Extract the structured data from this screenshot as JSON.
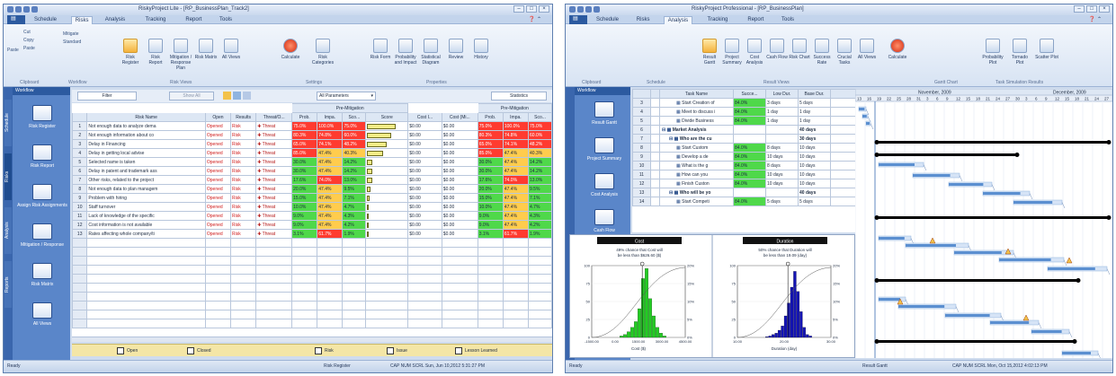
{
  "colors": {
    "accent": "#2c5aa0",
    "sidebar": "#5a86c9",
    "high": "#ff3b30",
    "medium": "#ffcc4d",
    "low": "#4fd84a",
    "histogram_cost": "#22cc22",
    "histogram_duration": "#1414b4",
    "gantt_bar": "#5b8fd0",
    "summary_bar": "#000000"
  },
  "left": {
    "title": "RiskyProject Lite - [RP_BusinessPlan_Track2]",
    "tabs": [
      "Schedule",
      "Risks",
      "Analysis",
      "Tracking",
      "Report",
      "Tools"
    ],
    "active_tab": "Risks",
    "ribbon": {
      "clipboard": [
        "Cut",
        "Copy",
        "Paste"
      ],
      "clipboard_label": "Clipboard",
      "workflow": [
        "Mitigate",
        "Standard"
      ],
      "workflow_label": "Workflow",
      "views": [
        "Risk Register",
        "Risk Report",
        "Mitigation / Response Plan",
        "Risk Matrix",
        "All Views"
      ],
      "views_label": "Risk Views",
      "settings": [
        "Calculate",
        "Risk Categories"
      ],
      "settings_label": "Settings",
      "properties": [
        "Risk Form",
        "Probability and Impact",
        "Statistical Diagram",
        "Review",
        "History"
      ],
      "properties_label": "Properties"
    },
    "sidebar": {
      "header": "Workflow",
      "vtabs": [
        "Schedule",
        "Risks",
        "Analysis",
        "Reports"
      ],
      "items": [
        "Risk Register",
        "Risk Report",
        "Assign Risk Assignments",
        "Mitigation / Response",
        "Risk Matrix",
        "All Views"
      ]
    },
    "toolbar": {
      "filter": "Filter",
      "show_all": "Show All",
      "params": "All Parameters",
      "statistics": "Statistics"
    },
    "groups": {
      "pre": "Pre-Mitigation",
      "post": "Pre-Mitigation"
    },
    "columns": [
      "Risk Name",
      "Open",
      "Results",
      "Threat/O...",
      "Prob.",
      "Impa.",
      "Sco...",
      "Score",
      "Cost I...",
      "Cost (Mi...",
      "Prob.",
      "Impa.",
      "Sco..."
    ],
    "rows": [
      {
        "n": 1,
        "name": "Not enough data to analyze dema",
        "open": "Opened",
        "res": "Risk",
        "thr": "Threat",
        "p": "75.0%",
        "i": "100.0%",
        "s": "75.0%",
        "ci": "$0.00",
        "cm": "$0.00",
        "p2": "75.0%",
        "i2": "100.0%",
        "s2": "75.0%",
        "lvl": [
          "red",
          "red",
          "red"
        ],
        "lvl2": [
          "red",
          "red",
          "red"
        ],
        "bar": 0.9
      },
      {
        "n": 2,
        "name": "Not enough information about co",
        "open": "Opened",
        "res": "Risk",
        "thr": "Threat",
        "p": "80.3%",
        "i": "74.8%",
        "s": "60.0%",
        "ci": "$0.00",
        "cm": "$0.00",
        "p2": "80.3%",
        "i2": "74.8%",
        "s2": "60.0%",
        "lvl": [
          "red",
          "red",
          "red"
        ],
        "lvl2": [
          "red",
          "red",
          "red"
        ],
        "bar": 0.75
      },
      {
        "n": 3,
        "name": "Delay in Financing",
        "open": "Opened",
        "res": "Risk",
        "thr": "Threat",
        "p": "65.0%",
        "i": "74.1%",
        "s": "48.2%",
        "ci": "$0.00",
        "cm": "$0.00",
        "p2": "65.0%",
        "i2": "74.1%",
        "s2": "48.2%",
        "lvl": [
          "red",
          "red",
          "red"
        ],
        "lvl2": [
          "red",
          "red",
          "red"
        ],
        "bar": 0.6
      },
      {
        "n": 4,
        "name": "Delay in getting local advise",
        "open": "Opened",
        "res": "Risk",
        "thr": "Threat",
        "p": "85.0%",
        "i": "47.4%",
        "s": "40.3%",
        "ci": "$0.00",
        "cm": "$0.00",
        "p2": "85.0%",
        "i2": "47.4%",
        "s2": "40.3%",
        "lvl": [
          "red",
          "amber",
          "amber"
        ],
        "lvl2": [
          "red",
          "amber",
          "amber"
        ],
        "bar": 0.5
      },
      {
        "n": 5,
        "name": "Selected name is taken",
        "open": "Opened",
        "res": "Risk",
        "thr": "Threat",
        "p": "30.0%",
        "i": "47.4%",
        "s": "14.2%",
        "ci": "$0.00",
        "cm": "$0.00",
        "p2": "30.0%",
        "i2": "47.4%",
        "s2": "14.2%",
        "lvl": [
          "green",
          "amber",
          "green"
        ],
        "lvl2": [
          "green",
          "amber",
          "green"
        ],
        "bar": 0.18
      },
      {
        "n": 6,
        "name": "Delay in patent and trademark ass",
        "open": "Opened",
        "res": "Risk",
        "thr": "Threat",
        "p": "30.0%",
        "i": "47.4%",
        "s": "14.2%",
        "ci": "$0.00",
        "cm": "$0.00",
        "p2": "30.0%",
        "i2": "47.4%",
        "s2": "14.2%",
        "lvl": [
          "green",
          "amber",
          "green"
        ],
        "lvl2": [
          "green",
          "amber",
          "green"
        ],
        "bar": 0.18
      },
      {
        "n": 7,
        "name": "Other risks, related to the project",
        "open": "Opened",
        "res": "Risk",
        "thr": "Threat",
        "p": "17.6%",
        "i": "74.0%",
        "s": "13.0%",
        "ci": "$0.00",
        "cm": "$0.00",
        "p2": "17.6%",
        "i2": "74.0%",
        "s2": "13.0%",
        "lvl": [
          "green",
          "red",
          "green"
        ],
        "lvl2": [
          "green",
          "red",
          "green"
        ],
        "bar": 0.16
      },
      {
        "n": 8,
        "name": "Not enough data to plan managem",
        "open": "Opened",
        "res": "Risk",
        "thr": "Threat",
        "p": "20.0%",
        "i": "47.4%",
        "s": "9.5%",
        "ci": "$0.00",
        "cm": "$0.00",
        "p2": "20.0%",
        "i2": "47.4%",
        "s2": "9.5%",
        "lvl": [
          "green",
          "amber",
          "green"
        ],
        "lvl2": [
          "green",
          "amber",
          "green"
        ],
        "bar": 0.12
      },
      {
        "n": 9,
        "name": "Problem with hiring",
        "open": "Opened",
        "res": "Risk",
        "thr": "Threat",
        "p": "15.0%",
        "i": "47.4%",
        "s": "7.1%",
        "ci": "$0.00",
        "cm": "$0.00",
        "p2": "15.0%",
        "i2": "47.4%",
        "s2": "7.1%",
        "lvl": [
          "green",
          "amber",
          "green"
        ],
        "lvl2": [
          "green",
          "amber",
          "green"
        ],
        "bar": 0.09
      },
      {
        "n": 10,
        "name": "Staff turnover",
        "open": "Opened",
        "res": "Risk",
        "thr": "Threat",
        "p": "10.0%",
        "i": "47.4%",
        "s": "4.7%",
        "ci": "$0.00",
        "cm": "$0.00",
        "p2": "10.0%",
        "i2": "47.4%",
        "s2": "4.7%",
        "lvl": [
          "green",
          "amber",
          "green"
        ],
        "lvl2": [
          "green",
          "amber",
          "green"
        ],
        "bar": 0.06
      },
      {
        "n": 11,
        "name": "Lack of knowledge of the specific",
        "open": "Opened",
        "res": "Risk",
        "thr": "Threat",
        "p": "9.0%",
        "i": "47.4%",
        "s": "4.3%",
        "ci": "$0.00",
        "cm": "$0.00",
        "p2": "9.0%",
        "i2": "47.4%",
        "s2": "4.3%",
        "lvl": [
          "green",
          "amber",
          "green"
        ],
        "lvl2": [
          "green",
          "amber",
          "green"
        ],
        "bar": 0.05
      },
      {
        "n": 12,
        "name": "Cost information is not available",
        "open": "Opened",
        "res": "Risk",
        "thr": "Threat",
        "p": "9.0%",
        "i": "47.4%",
        "s": "4.2%",
        "ci": "$0.00",
        "cm": "$0.00",
        "p2": "9.0%",
        "i2": "47.4%",
        "s2": "4.2%",
        "lvl": [
          "green",
          "amber",
          "green"
        ],
        "lvl2": [
          "green",
          "amber",
          "green"
        ],
        "bar": 0.05
      },
      {
        "n": 13,
        "name": "Rates affecting whole company/ti",
        "open": "Opened",
        "res": "Risk",
        "thr": "Threat",
        "p": "3.1%",
        "i": "61.7%",
        "s": "1.9%",
        "ci": "$0.00",
        "cm": "$0.00",
        "p2": "3.1%",
        "i2": "61.7%",
        "s2": "1.9%",
        "lvl": [
          "green",
          "red",
          "green"
        ],
        "lvl2": [
          "green",
          "red",
          "green"
        ],
        "bar": 0.03
      }
    ],
    "legend": [
      "Open",
      "Closed",
      "Risk",
      "Issue",
      "Lesson Learned"
    ],
    "status": {
      "left": "Ready",
      "center": "Risk Register",
      "right": "CAP NUM SCRL  Sun, Jun 10,2012  5:31:27 PM"
    }
  },
  "right": {
    "title": "RiskyProject Professional - [RP_BusinessPlan]",
    "tabs": [
      "Schedule",
      "Risks",
      "Analysis",
      "Tracking",
      "Report",
      "Tools"
    ],
    "active_tab": "Analysis",
    "ribbon": {
      "clipboard_label": "Clipboard",
      "schedule_label": "Schedule",
      "views": [
        "Result Gantt",
        "Project Summary",
        "Cost Analysis",
        "Cash Flow",
        "Risk Chart",
        "Success Rate",
        "Crucial Tasks",
        "All Views"
      ],
      "views_label": "Result Views",
      "calc": [
        "Calculate"
      ],
      "gantt_label": "Gantt Chart",
      "sens": [
        "Probability Plot",
        "Tornado Plot",
        "Scatter Plot"
      ],
      "sens_label": "Task Simulation Results"
    },
    "sidebar": {
      "header": "Workflow",
      "items": [
        "Result Gantt",
        "Project Summary",
        "Cost Analysis",
        "Cash Flow"
      ]
    },
    "columns": [
      "Task Name",
      "Succe...",
      "Low Dur.",
      "Base Dur."
    ],
    "rows": [
      {
        "n": 3,
        "name": "Start Creation of",
        "succ": "84.0%",
        "low": "3 days",
        "base": "5 days",
        "indent": 2
      },
      {
        "n": 4,
        "name": "Meet to discuss i",
        "succ": "84.0%",
        "low": "1 day",
        "base": "1 day",
        "indent": 2
      },
      {
        "n": 5,
        "name": "Divide Business",
        "succ": "84.0%",
        "low": "1 day",
        "base": "1 day",
        "indent": 2
      },
      {
        "n": 6,
        "name": "Market Analysis",
        "succ": "",
        "low": "",
        "base": "40 days",
        "indent": 0,
        "summary": true
      },
      {
        "n": 7,
        "name": "Who are the cu",
        "succ": "",
        "low": "",
        "base": "30 days",
        "indent": 1,
        "summary": true
      },
      {
        "n": 8,
        "name": "Start Custom",
        "succ": "84.0%",
        "low": "8 days",
        "base": "10 days",
        "indent": 2
      },
      {
        "n": 9,
        "name": "Develop a de",
        "succ": "84.0%",
        "low": "10 days",
        "base": "10 days",
        "indent": 2
      },
      {
        "n": 10,
        "name": "What is the g",
        "succ": "84.0%",
        "low": "8 days",
        "base": "10 days",
        "indent": 2
      },
      {
        "n": 11,
        "name": "How can you",
        "succ": "84.0%",
        "low": "10 days",
        "base": "10 days",
        "indent": 2
      },
      {
        "n": 12,
        "name": "Finish Custon",
        "succ": "84.0%",
        "low": "10 days",
        "base": "10 days",
        "indent": 2
      },
      {
        "n": 13,
        "name": "Who will be yo",
        "succ": "",
        "low": "",
        "base": "40 days",
        "indent": 1,
        "summary": true
      },
      {
        "n": 14,
        "name": "Start Competi",
        "succ": "84.0%",
        "low": "5 days",
        "base": "5 days",
        "indent": 2
      }
    ],
    "timeline": {
      "months": [
        "November, 2009",
        "December, 2009"
      ],
      "days": [
        "13",
        "16",
        "19",
        "22",
        "25",
        "28",
        "31",
        "3",
        "6",
        "9",
        "12",
        "15",
        "18",
        "21",
        "24",
        "27",
        "30",
        "3",
        "6",
        "9",
        "12",
        "15",
        "18",
        "21",
        "24",
        "27"
      ]
    },
    "cost_hist": {
      "title": "Cost",
      "caption": "49% chance that Cost will be less than $626.60 ($)",
      "x_ticks": [
        "-1500.00",
        "0.00",
        "1500.00",
        "3000.00",
        "4500.00"
      ],
      "y_ticks": [
        "100",
        "75",
        "50",
        "25",
        "0"
      ],
      "y2_ticks": [
        "20%",
        "15%",
        "10%",
        "5%",
        "0%"
      ],
      "xlabel": "Cost ($)",
      "values": [
        2,
        4,
        8,
        14,
        22,
        40,
        82,
        96,
        54,
        30,
        14,
        6,
        2
      ]
    },
    "dur_hist": {
      "title": "Duration",
      "caption": "50% chance that Duration will be less than 19.09 (day)",
      "x_ticks": [
        "10.00",
        "20.00",
        "30.00"
      ],
      "y_ticks": [
        "100",
        "75",
        "50",
        "25",
        "0"
      ],
      "y2_ticks": [
        "20%",
        "15%",
        "10%",
        "5%",
        "0%"
      ],
      "xlabel": "Duration (day)",
      "values": [
        1,
        2,
        4,
        6,
        10,
        16,
        30,
        48,
        70,
        92,
        64,
        36,
        14,
        4,
        2
      ]
    },
    "status": {
      "left": "Ready",
      "center": "Result Gantt",
      "right": "CAP NUM SCRL  Mon, Oct 15,2012  4:02:13 PM"
    }
  }
}
